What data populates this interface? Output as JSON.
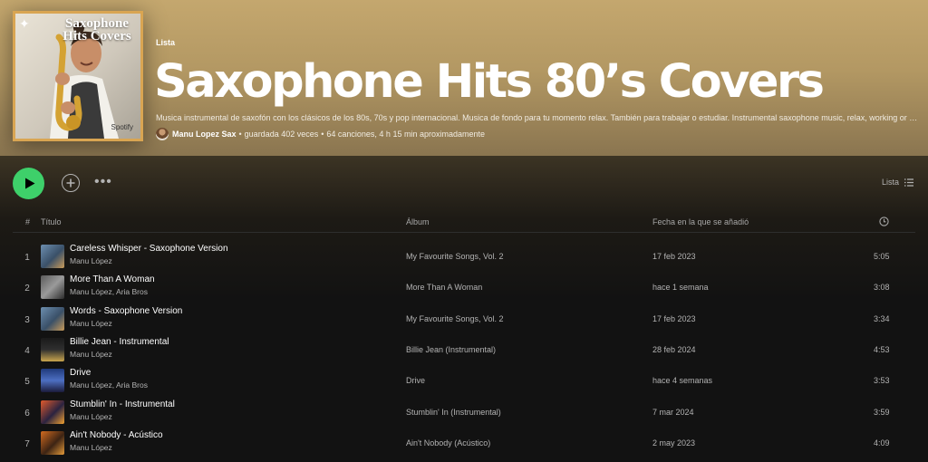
{
  "header": {
    "cover_title": "Saxophone Hits Covers",
    "cover_spotify": "Spotify",
    "type_label": "Lista",
    "title": "Saxophone Hits 80’s Covers",
    "description": "Musica instrumental de saxofón con los clásicos de los 80s, 70s y pop internacional. Musica de fondo para tu momento relax. También para trabajar o estudiar. Instrumental saxophone music, relax, working or studying...",
    "owner": "Manu Lopez Sax",
    "saves": "guardada 402 veces",
    "summary": "64 canciones, 4 h 15 min aproximadamente",
    "separator": "•"
  },
  "controls": {
    "more": "•••",
    "view_label": "Lista"
  },
  "table": {
    "col_num": "#",
    "col_title": "Título",
    "col_album": "Álbum",
    "col_date": "Fecha en la que se añadió"
  },
  "tracks": [
    {
      "num": "1",
      "title": "Careless Whisper - Saxophone Version",
      "artist": "Manu López",
      "album": "My Favourite Songs, Vol. 2",
      "date": "17 feb 2023",
      "duration": "5:05"
    },
    {
      "num": "2",
      "title": "More Than A Woman",
      "artist": "Manu López, Aria Bros",
      "album": "More Than A Woman",
      "date": "hace 1 semana",
      "duration": "3:08"
    },
    {
      "num": "3",
      "title": "Words - Saxophone Version",
      "artist": "Manu López",
      "album": "My Favourite Songs, Vol. 2",
      "date": "17 feb 2023",
      "duration": "3:34"
    },
    {
      "num": "4",
      "title": "Billie Jean - Instrumental",
      "artist": "Manu López",
      "album": "Billie Jean (Instrumental)",
      "date": "28 feb 2024",
      "duration": "4:53"
    },
    {
      "num": "5",
      "title": "Drive",
      "artist": "Manu López, Aria Bros",
      "album": "Drive",
      "date": "hace 4 semanas",
      "duration": "3:53"
    },
    {
      "num": "6",
      "title": "Stumblin' In - Instrumental",
      "artist": "Manu López",
      "album": "Stumblin' In (Instrumental)",
      "date": "7 mar 2024",
      "duration": "3:59"
    },
    {
      "num": "7",
      "title": "Ain't Nobody - Acústico",
      "artist": "Manu López",
      "album": "Ain't Nobody (Acústico)",
      "date": "2 may 2023",
      "duration": "4:09"
    }
  ],
  "colors": {
    "header_gold": "#c4a76e",
    "play_green": "#3ed06a",
    "background": "#121212"
  }
}
